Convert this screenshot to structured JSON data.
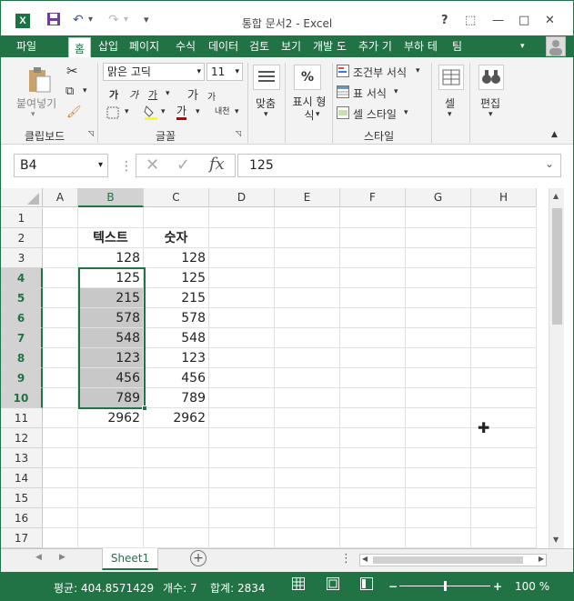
{
  "window": {
    "title": "통합 문서2 - Excel",
    "logo": "X",
    "help": "?",
    "restore_ribbon": "⬚",
    "minimize": "—",
    "maximize": "□",
    "close": "✕"
  },
  "quick_access": {
    "save_icon": "save-icon",
    "undo": "↶",
    "redo": "↷",
    "customize": "▾"
  },
  "tabs": [
    "파일",
    "홈",
    "삽입",
    "페이지",
    "수식",
    "데이터",
    "검토",
    "보기",
    "개발 도",
    "추가 기",
    "부하 테",
    "팀"
  ],
  "ribbon": {
    "clipboard": {
      "label": "클립보드",
      "paste": "붙여넣기"
    },
    "font": {
      "label": "글꼴",
      "name": "맑은 고딕",
      "size": "11",
      "bold": "가",
      "italic": "가",
      "underline": "가",
      "grow": "가",
      "shrink": "가",
      "highlight": "가",
      "font_color": "가",
      "phonetic": "내천"
    },
    "alignment": {
      "label": "맞춤"
    },
    "number": {
      "label": "표시 형식",
      "symbol": "%"
    },
    "styles": {
      "label": "스타일",
      "conditional": "조건부 서식",
      "table": "표 서식",
      "cell_style": "셀 스타일"
    },
    "cells": {
      "label": "셀"
    },
    "editing": {
      "label": "편집"
    }
  },
  "formula_bar": {
    "name_box": "B4",
    "fx": "fx",
    "value": "125"
  },
  "columns": [
    "A",
    "B",
    "C",
    "D",
    "E",
    "F",
    "G",
    "H"
  ],
  "rows": [
    "1",
    "2",
    "3",
    "4",
    "5",
    "6",
    "7",
    "8",
    "9",
    "10",
    "11",
    "12",
    "13",
    "14",
    "15",
    "16",
    "17"
  ],
  "cells": {
    "B2": "텍스트",
    "C2": "숫자",
    "B3": "128",
    "C3": "128",
    "B4": "125",
    "C4": "125",
    "B5": "215",
    "C5": "215",
    "B6": "578",
    "C6": "578",
    "B7": "548",
    "C7": "548",
    "B8": "123",
    "C8": "123",
    "B9": "456",
    "C9": "456",
    "B10": "789",
    "C10": "789",
    "B11": "2962",
    "C11": "2962"
  },
  "sheets": {
    "active": "Sheet1",
    "add": "+"
  },
  "status": {
    "average": "평균: 404.8571429",
    "count": "개수: 7",
    "sum": "합계: 2834",
    "zoom": "100 %",
    "zoom_fraction": 0.5
  }
}
